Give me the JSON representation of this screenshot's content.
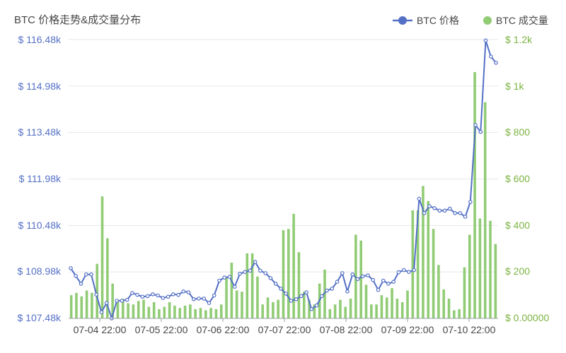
{
  "colors": {
    "price": "#5470c6",
    "volume": "#91cc75",
    "left_axis_text": "#5470c6",
    "right_axis_text": "#7cb342",
    "grid": "#e6e6e6",
    "axis": "#9aa0a6"
  },
  "chart_data": {
    "type": "bar+line",
    "title": "BTC 价格走势&成交量分布",
    "legend": {
      "placement": "top-right",
      "entries": [
        {
          "name": "BTC 价格",
          "shape": "line-circle"
        },
        {
          "name": "BTC 成交量",
          "shape": "circle"
        }
      ]
    },
    "x_tick_labels": [
      "07-04 22:00",
      "07-05 22:00",
      "07-06 22:00",
      "07-07 22:00",
      "07-08 22:00",
      "07-09 22:00",
      "07-10 22:00"
    ],
    "y_left": {
      "ticks": [
        "$ 107.48k",
        "$ 108.98k",
        "$ 110.48k",
        "$ 111.98k",
        "$ 113.48k",
        "$ 114.98k",
        "$ 116.48k"
      ],
      "range": [
        107480,
        116480
      ]
    },
    "y_right": {
      "ticks": [
        "$ 0.00000",
        "$ 200",
        "$ 400",
        "$ 600",
        "$ 800",
        "$ 1k",
        "$ 1.2k"
      ],
      "range": [
        0,
        1200
      ]
    },
    "grid": true,
    "series": [
      {
        "name": "BTC 价格",
        "type": "line",
        "axis": "left",
        "values": [
          109.1,
          108.85,
          108.6,
          108.9,
          108.9,
          108.25,
          107.68,
          107.98,
          107.48,
          108.05,
          108.05,
          108.08,
          108.3,
          108.24,
          108.18,
          108.2,
          108.26,
          108.22,
          108.14,
          108.18,
          108.26,
          108.24,
          108.35,
          108.32,
          108.1,
          108.12,
          108.12,
          107.98,
          108.22,
          108.7,
          108.8,
          108.82,
          108.5,
          108.92,
          108.98,
          109.02,
          109.3,
          109.02,
          108.94,
          108.78,
          108.6,
          108.44,
          108.28,
          108.05,
          108.1,
          108.2,
          108.32,
          107.78,
          107.9,
          108.2,
          108.38,
          108.44,
          108.66,
          108.94,
          108.35,
          108.9,
          108.75,
          108.84,
          108.87,
          108.72,
          108.4,
          108.7,
          108.6,
          108.66,
          108.97,
          109.04,
          108.98,
          109.04,
          111.34,
          110.88,
          111.1,
          111.04,
          110.96,
          110.96,
          111.02,
          110.88,
          110.88,
          110.76,
          111.24,
          113.72,
          113.5,
          116.45,
          115.93,
          115.73
        ]
      },
      {
        "name": "BTC 成交量",
        "type": "bar",
        "axis": "right",
        "values": [
          100,
          110,
          95,
          120,
          110,
          235,
          525,
          345,
          150,
          80,
          85,
          65,
          60,
          75,
          80,
          50,
          70,
          40,
          50,
          70,
          55,
          45,
          55,
          60,
          40,
          45,
          35,
          45,
          40,
          60,
          175,
          240,
          120,
          115,
          280,
          280,
          180,
          60,
          90,
          70,
          80,
          380,
          385,
          450,
          285,
          115,
          80,
          60,
          150,
          210,
          40,
          60,
          80,
          50,
          85,
          360,
          335,
          145,
          60,
          60,
          100,
          90,
          130,
          85,
          70,
          120,
          465,
          465,
          570,
          505,
          385,
          230,
          125,
          85,
          35,
          40,
          220,
          360,
          1060,
          430,
          930,
          420,
          320
        ]
      }
    ]
  }
}
